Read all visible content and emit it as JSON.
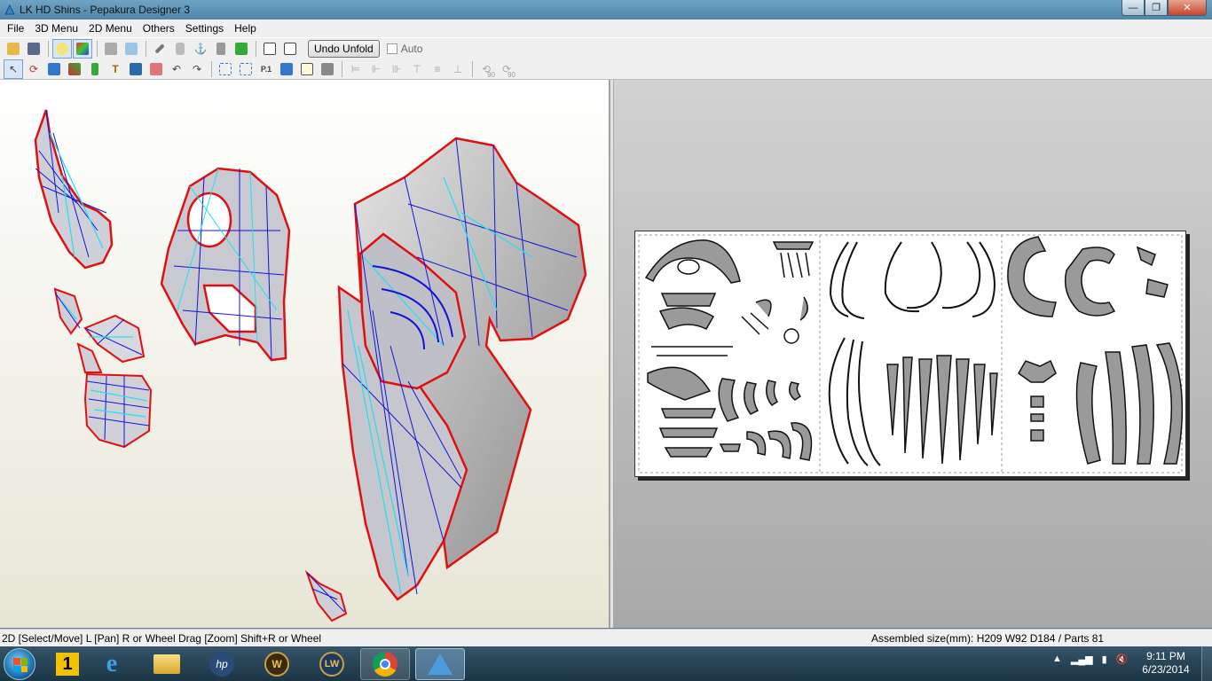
{
  "window": {
    "title": "LK HD Shins - Pepakura Designer 3",
    "controls": [
      "minimize",
      "maximize",
      "close"
    ]
  },
  "menubar": {
    "items": [
      "File",
      "3D Menu",
      "2D Menu",
      "Others",
      "Settings",
      "Help"
    ]
  },
  "toolbar1": {
    "icons": [
      "open-icon",
      "save-icon",
      "light-bulb-icon",
      "texture-icon",
      "3d-box-icon",
      "2d-box-icon",
      "edit-pencil-icon",
      "cylinder-icon",
      "anchor-icon",
      "flap-icon",
      "lightning-icon",
      "single-pane-icon",
      "split-pane-icon"
    ],
    "undo_unfold_label": "Undo Unfold",
    "auto_label": "Auto"
  },
  "toolbar2": {
    "icons": [
      "select-move-icon",
      "rotate-part-icon",
      "join-edge-icon",
      "flap-edit-icon",
      "texture-part-icon",
      "text-icon",
      "image-icon",
      "shape-icon",
      "undo-icon",
      "redo-icon",
      "page-settings-icon",
      "arrange-icon",
      "page-number-icon",
      "print-layout-icon",
      "calendar-icon",
      "print-icon",
      "align-left-icon",
      "align-center-icon",
      "align-right-icon",
      "align-top-icon",
      "align-middle-icon",
      "align-bottom-icon",
      "rotate-left-90-icon",
      "rotate-right-90-icon"
    ],
    "rotate_left_label": "90",
    "rotate_right_label": "90"
  },
  "statusbar": {
    "left": "2D [Select/Move] L [Pan] R or Wheel Drag [Zoom] Shift+R or Wheel",
    "right": "Assembled size(mm): H209 W92 D184 / Parts 81"
  },
  "taskbar": {
    "apps": [
      {
        "name": "start-orb",
        "running": false
      },
      {
        "name": "app-1-icon",
        "label": "1",
        "running": false
      },
      {
        "name": "internet-explorer-icon",
        "running": false
      },
      {
        "name": "file-explorer-icon",
        "running": false
      },
      {
        "name": "hp-icon",
        "running": false
      },
      {
        "name": "world-of-warcraft-icon",
        "running": false
      },
      {
        "name": "lw-icon",
        "label": "LW",
        "running": false
      },
      {
        "name": "chrome-icon",
        "running": true
      },
      {
        "name": "pepakura-icon",
        "running": true
      }
    ],
    "clock_time": "9:11 PM",
    "clock_date": "6/23/2014"
  },
  "colors": {
    "cut_edge": "#e01010",
    "mesh_edge": "#1414d8",
    "fold_edge": "#20e0f0",
    "part_fill": "#c8c8c8",
    "print_part_fill": "#9a9a9a"
  }
}
